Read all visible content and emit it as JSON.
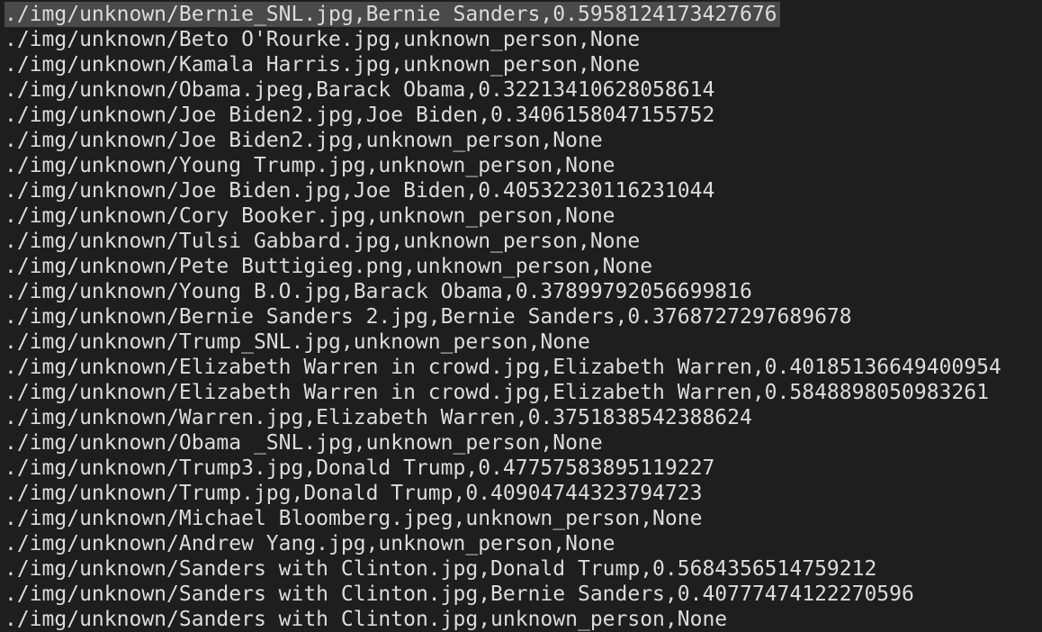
{
  "terminal": {
    "selected_line_index": 0,
    "lines": [
      "./img/unknown/Bernie_SNL.jpg,Bernie Sanders,0.5958124173427676",
      "./img/unknown/Beto O'Rourke.jpg,unknown_person,None",
      "./img/unknown/Kamala Harris.jpg,unknown_person,None",
      "./img/unknown/Obama.jpeg,Barack Obama,0.32213410628058614",
      "./img/unknown/Joe Biden2.jpg,Joe Biden,0.3406158047155752",
      "./img/unknown/Joe Biden2.jpg,unknown_person,None",
      "./img/unknown/Young Trump.jpg,unknown_person,None",
      "./img/unknown/Joe Biden.jpg,Joe Biden,0.40532230116231044",
      "./img/unknown/Cory Booker.jpg,unknown_person,None",
      "./img/unknown/Tulsi Gabbard.jpg,unknown_person,None",
      "./img/unknown/Pete Buttigieg.png,unknown_person,None",
      "./img/unknown/Young B.O.jpg,Barack Obama,0.37899792056699816",
      "./img/unknown/Bernie Sanders 2.jpg,Bernie Sanders,0.3768727297689678",
      "./img/unknown/Trump_SNL.jpg,unknown_person,None",
      "./img/unknown/Elizabeth Warren in crowd.jpg,Elizabeth Warren,0.40185136649400954",
      "./img/unknown/Elizabeth Warren in crowd.jpg,Elizabeth Warren,0.5848898050983261",
      "./img/unknown/Warren.jpg,Elizabeth Warren,0.3751838542388624",
      "./img/unknown/Obama _SNL.jpg,unknown_person,None",
      "./img/unknown/Trump3.jpg,Donald Trump,0.47757583895119227",
      "./img/unknown/Trump.jpg,Donald Trump,0.40904744323794723",
      "./img/unknown/Michael Bloomberg.jpeg,unknown_person,None",
      "./img/unknown/Andrew Yang.jpg,unknown_person,None",
      "./img/unknown/Sanders with Clinton.jpg,Donald Trump,0.5684356514759212",
      "./img/unknown/Sanders with Clinton.jpg,Bernie Sanders,0.40777474122270596",
      "./img/unknown/Sanders with Clinton.jpg,unknown_person,None"
    ]
  }
}
